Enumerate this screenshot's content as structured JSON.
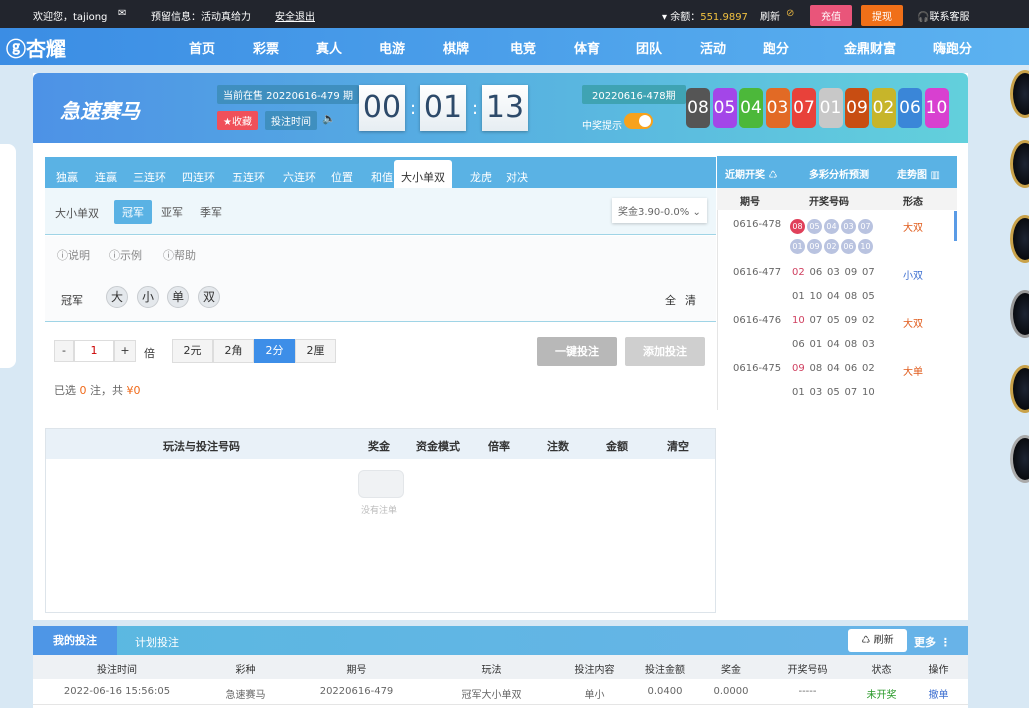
{
  "topbar": {
    "welcome": "欢迎您，tajiong",
    "notice": "预留信息：活动真给力",
    "logout": "安全退出",
    "balance_label": "余额：",
    "balance": "551.9897",
    "refresh": "刷新",
    "deposit": "充值",
    "withdraw": "提现",
    "support": "联系客服"
  },
  "nav": {
    "logo": "杏耀",
    "items": [
      "首页",
      "彩票",
      "真人",
      "电游",
      "棋牌",
      "电竞",
      "体育",
      "团队",
      "活动",
      "跑分",
      "金鼎财富",
      "嗨跑分"
    ]
  },
  "game": {
    "title": "急速赛马",
    "current_issue": "当前在售 20220616-479 期",
    "favorite": "★收藏",
    "bet_time": "投注时间",
    "countdown": [
      "00",
      "01",
      "13"
    ],
    "last_issue": "20220616-478期",
    "win_alert": "中奖提示",
    "balls": [
      {
        "n": "08",
        "c": "#555555"
      },
      {
        "n": "05",
        "c": "#a346e8"
      },
      {
        "n": "04",
        "c": "#4cb83a"
      },
      {
        "n": "03",
        "c": "#e26a25"
      },
      {
        "n": "07",
        "c": "#e8413a"
      },
      {
        "n": "01",
        "c": "#c8c8c8"
      },
      {
        "n": "09",
        "c": "#c84d12"
      },
      {
        "n": "02",
        "c": "#c7b52a"
      },
      {
        "n": "06",
        "c": "#3a86d8"
      },
      {
        "n": "10",
        "c": "#d840d0"
      }
    ]
  },
  "tabs": [
    "独赢",
    "连赢",
    "三连环",
    "四连环",
    "五连环",
    "六连环",
    "位置",
    "和值",
    "大小单双",
    "龙虎",
    "对决"
  ],
  "active_tab": 8,
  "subtabs": {
    "label": "大小单双",
    "items": [
      "冠军",
      "亚军",
      "季军"
    ],
    "prize": "奖金3.90-0.0%"
  },
  "help": [
    "说明",
    "示例",
    "帮助"
  ],
  "pick": {
    "label": "冠军",
    "options": [
      "大",
      "小",
      "单",
      "双"
    ],
    "all": "全",
    "clear": "清"
  },
  "bet": {
    "minus": "-",
    "multiplier": "1",
    "plus": "+",
    "unit": "倍",
    "modes": [
      "2元",
      "2角",
      "2分",
      "2厘"
    ],
    "active_mode": 2,
    "quick_bet": "一键投注",
    "add_bet": "添加投注",
    "sel_prefix": "已选",
    "sel_count": "0",
    "sel_mid": "注，共",
    "sel_amount": "¥0"
  },
  "history": {
    "tabs": [
      "近期开奖",
      "多彩分析预测",
      "走势图"
    ],
    "cols": [
      "期号",
      "开奖号码",
      "形态"
    ],
    "rows": [
      {
        "issue": "0616-478",
        "line1": [
          "08",
          "05",
          "04",
          "03",
          "07"
        ],
        "line2": [
          "01",
          "09",
          "02",
          "06",
          "10"
        ],
        "form": "大双"
      },
      {
        "issue": "0616-477",
        "line1": [
          "02",
          "06",
          "03",
          "09",
          "07"
        ],
        "line2": [
          "01",
          "10",
          "04",
          "08",
          "05"
        ],
        "form": "小双"
      },
      {
        "issue": "0616-476",
        "line1": [
          "10",
          "07",
          "05",
          "09",
          "02"
        ],
        "line2": [
          "06",
          "01",
          "04",
          "08",
          "03"
        ],
        "form": "大双"
      },
      {
        "issue": "0616-475",
        "line1": [
          "09",
          "08",
          "04",
          "06",
          "02"
        ],
        "line2": [
          "01",
          "03",
          "05",
          "07",
          "10"
        ],
        "form": "大单"
      }
    ]
  },
  "betlist": {
    "cols": [
      "玩法与投注号码",
      "奖金",
      "资金模式",
      "倍率",
      "注数",
      "金额",
      "清空"
    ],
    "empty": "没有注单"
  },
  "records": {
    "tabs": [
      "我的投注",
      "计划投注"
    ],
    "refresh": "刷新",
    "more": "更多",
    "cols": [
      "投注时间",
      "彩种",
      "期号",
      "玩法",
      "投注内容",
      "投注金额",
      "奖金",
      "开奖号码",
      "状态",
      "操作"
    ],
    "rows": [
      [
        "2022-06-16 15:56:05",
        "急速赛马",
        "20220616-479",
        "冠军大小单双",
        "单小",
        "0.0400",
        "0.0000",
        "-----",
        "未开奖",
        "撤单"
      ]
    ]
  }
}
